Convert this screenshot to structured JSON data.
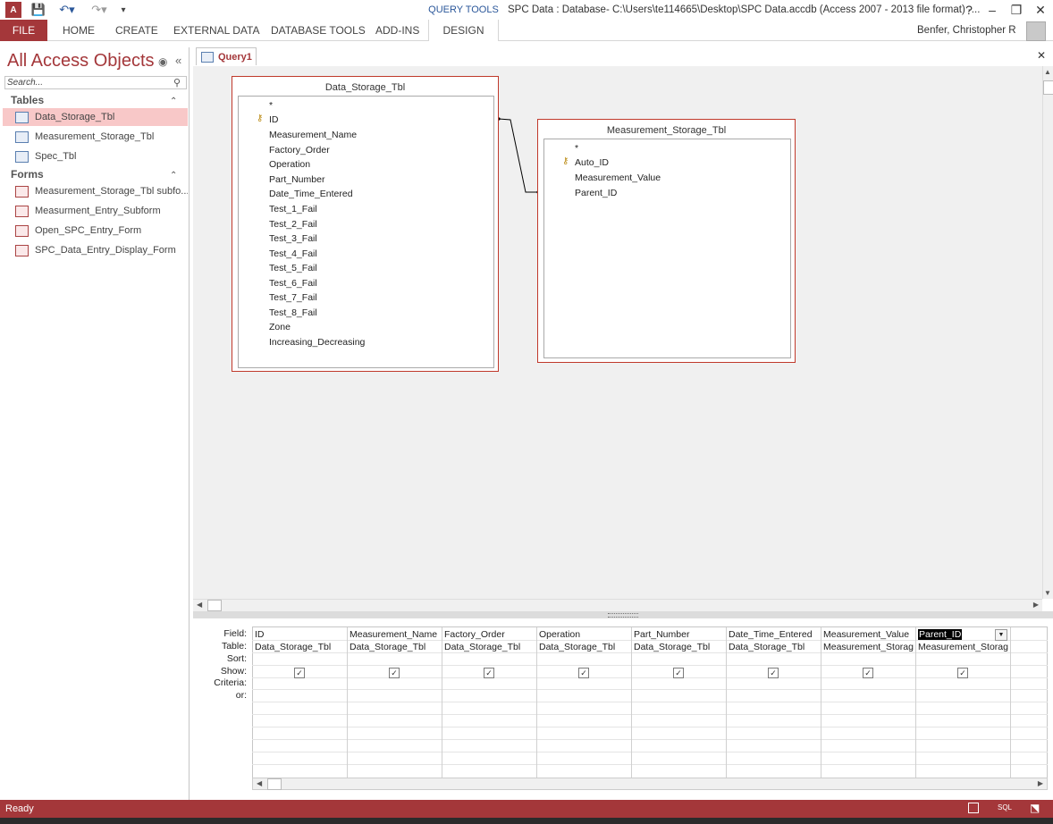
{
  "titlebar": {
    "title": "SPC Data : Database- C:\\Users\\te114665\\Desktop\\SPC Data.accdb (Access 2007 - 2013 file format) -...",
    "context_group": "QUERY TOOLS",
    "help": "?",
    "minimize": "–",
    "restore": "❐",
    "close": "✕"
  },
  "ribbon": {
    "file": "FILE",
    "tabs": [
      "HOME",
      "CREATE",
      "EXTERNAL DATA",
      "DATABASE TOOLS",
      "ADD-INS"
    ],
    "design": "DESIGN",
    "user": "Benfer, Christopher R"
  },
  "nav": {
    "title": "All Access Objects",
    "search_placeholder": "Search...",
    "groups": [
      {
        "label": "Tables",
        "items": [
          "Data_Storage_Tbl",
          "Measurement_Storage_Tbl",
          "Spec_Tbl"
        ]
      },
      {
        "label": "Forms",
        "items": [
          "Measurement_Storage_Tbl subfo...",
          "Measurment_Entry_Subform",
          "Open_SPC_Entry_Form",
          "SPC_Data_Entry_Display_Form"
        ]
      }
    ]
  },
  "document": {
    "tab": "Query1",
    "close": "✕"
  },
  "tables": [
    {
      "name": "Data_Storage_Tbl",
      "fields": [
        "*",
        "ID",
        "Measurement_Name",
        "Factory_Order",
        "Operation",
        "Part_Number",
        "Date_Time_Entered",
        "Test_1_Fail",
        "Test_2_Fail",
        "Test_3_Fail",
        "Test_4_Fail",
        "Test_5_Fail",
        "Test_6_Fail",
        "Test_7_Fail",
        "Test_8_Fail",
        "Zone",
        "Increasing_Decreasing"
      ]
    },
    {
      "name": "Measurement_Storage_Tbl",
      "fields": [
        "*",
        "Auto_ID",
        "Measurement_Value",
        "Parent_ID"
      ]
    }
  ],
  "grid": {
    "row_labels": [
      "Field:",
      "Table:",
      "Sort:",
      "Show:",
      "Criteria:",
      "or:"
    ],
    "columns": [
      {
        "field": "ID",
        "table": "Data_Storage_Tbl"
      },
      {
        "field": "Measurement_Name",
        "table": "Data_Storage_Tbl"
      },
      {
        "field": "Factory_Order",
        "table": "Data_Storage_Tbl"
      },
      {
        "field": "Operation",
        "table": "Data_Storage_Tbl"
      },
      {
        "field": "Part_Number",
        "table": "Data_Storage_Tbl"
      },
      {
        "field": "Date_Time_Entered",
        "table": "Data_Storage_Tbl"
      },
      {
        "field": "Measurement_Value",
        "table": "Measurement_Storag"
      },
      {
        "field": "Parent_ID",
        "table": "Measurement_Storag"
      }
    ],
    "check": "✓"
  },
  "status": {
    "text": "Ready"
  },
  "colors": {
    "accent": "#a4373a",
    "query_tools": "#2b579a"
  }
}
